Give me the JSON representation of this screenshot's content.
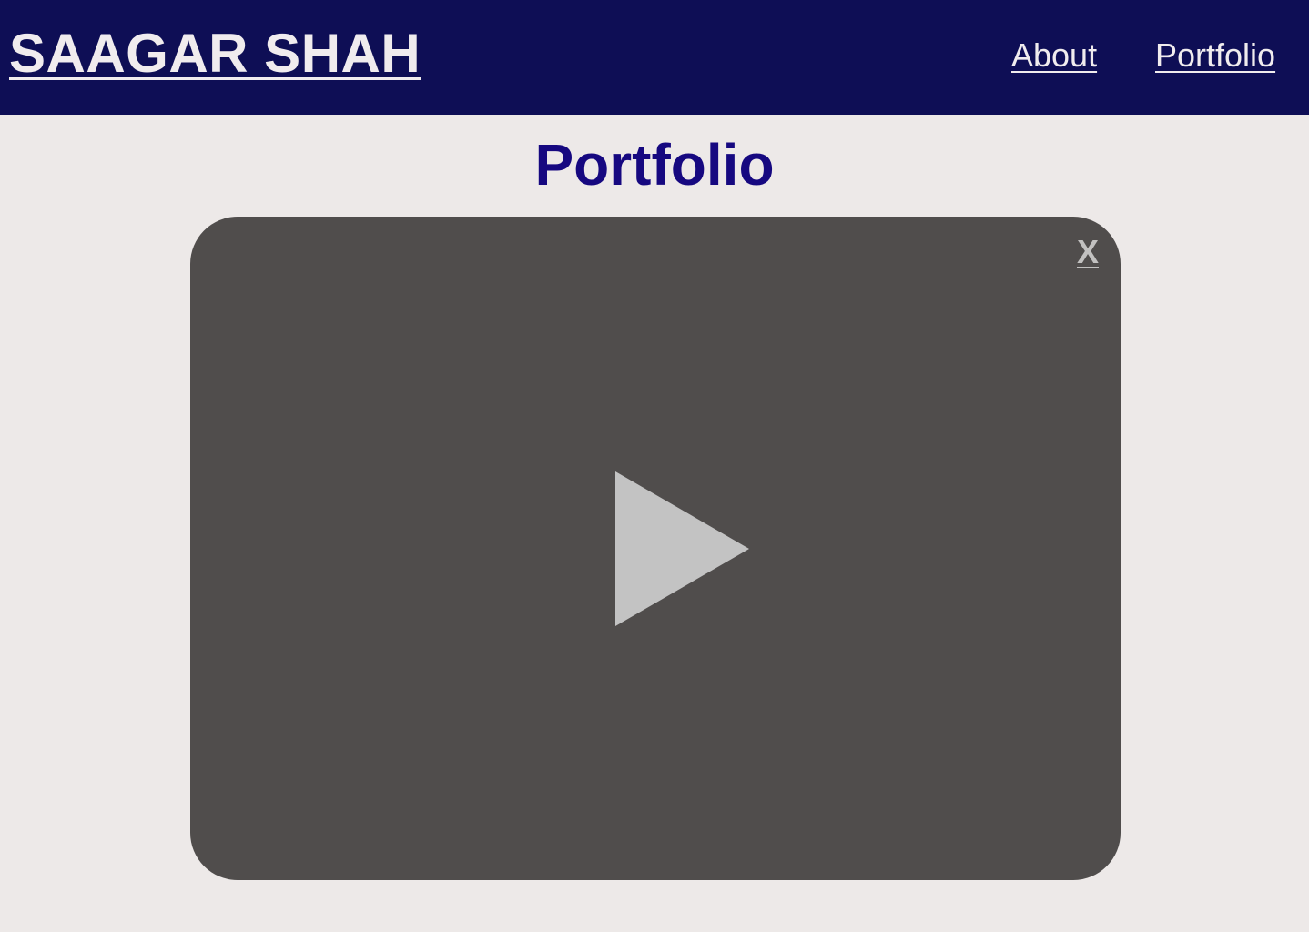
{
  "header": {
    "site_title": "SAAGAR SHAH",
    "nav": [
      {
        "label": "About"
      },
      {
        "label": "Portfolio"
      }
    ]
  },
  "main": {
    "title": "Portfolio",
    "video": {
      "close_label": "X",
      "play_icon": "play-icon"
    }
  },
  "colors": {
    "header_bg": "#0e0e55",
    "page_bg": "#ede9e8",
    "title": "#160880",
    "video_bg": "#504d4c",
    "play": "#c3c3c3"
  }
}
